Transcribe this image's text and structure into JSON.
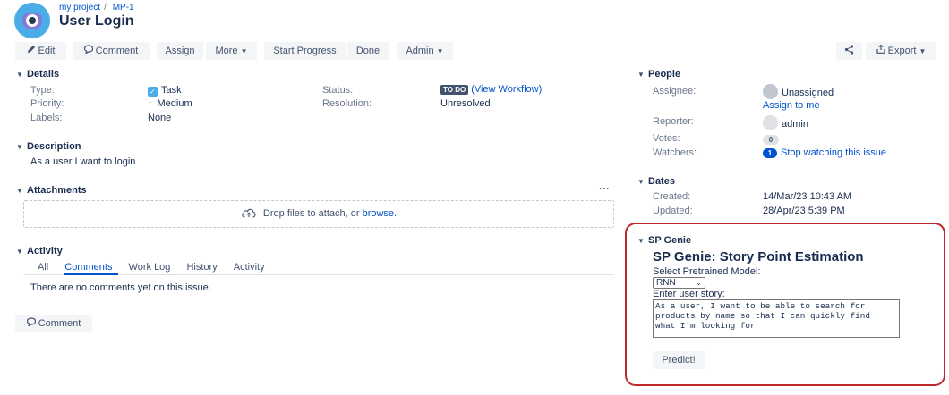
{
  "header": {
    "breadcrumb_project": "my project",
    "breadcrumb_sep": "/",
    "breadcrumb_issue": "MP-1",
    "title": "User Login"
  },
  "toolbar": {
    "edit": "Edit",
    "comment": "Comment",
    "assign": "Assign",
    "more": "More",
    "start_progress": "Start Progress",
    "done": "Done",
    "admin": "Admin",
    "export": "Export"
  },
  "details": {
    "heading": "Details",
    "type_label": "Type:",
    "type_value": "Task",
    "priority_label": "Priority:",
    "priority_value": "Medium",
    "labels_label": "Labels:",
    "labels_value": "None",
    "status_label": "Status:",
    "status_badge": "TO DO",
    "status_link": "(View Workflow)",
    "resolution_label": "Resolution:",
    "resolution_value": "Unresolved"
  },
  "description": {
    "heading": "Description",
    "text": "As a user I want to login"
  },
  "attachments": {
    "heading": "Attachments",
    "more": "···",
    "drop_text": "Drop files to attach, or",
    "browse": "browse."
  },
  "activity": {
    "heading": "Activity",
    "tabs": [
      "All",
      "Comments",
      "Work Log",
      "History",
      "Activity"
    ],
    "active_tab": "Comments",
    "empty": "There are no comments yet on this issue.",
    "comment_button": "Comment"
  },
  "people": {
    "heading": "People",
    "assignee_label": "Assignee:",
    "assignee_value": "Unassigned",
    "assign_to_me": "Assign to me",
    "reporter_label": "Reporter:",
    "reporter_value": "admin",
    "votes_label": "Votes:",
    "votes_count": "0",
    "watchers_label": "Watchers:",
    "watchers_count": "1",
    "watch_link": "Stop watching this issue"
  },
  "dates": {
    "heading": "Dates",
    "created_label": "Created:",
    "created_value": "14/Mar/23 10:43 AM",
    "updated_label": "Updated:",
    "updated_value": "28/Apr/23 5:39 PM"
  },
  "genie": {
    "section": "SP Genie",
    "title": "SP Genie: Story Point Estimation",
    "model_label": "Select Pretrained Model:",
    "model_value": "RNN",
    "story_label": "Enter user story:",
    "story_text": "As a user, I want to be able to search for\nproducts by name so that I can quickly find\nwhat I'm looking for",
    "predict": "Predict!"
  },
  "icons": {
    "edit": "pencil-icon",
    "comment": "speech-bubble-icon",
    "share": "share-icon",
    "export": "export-icon",
    "upload": "cloud-upload-icon",
    "priority": "arrow-up-icon",
    "type": "checkbox-icon"
  },
  "colors": {
    "accent": "#0052cc",
    "highlight_border": "#c0292a",
    "priority": "#f79232",
    "button_bg": "#f4f5f7"
  }
}
